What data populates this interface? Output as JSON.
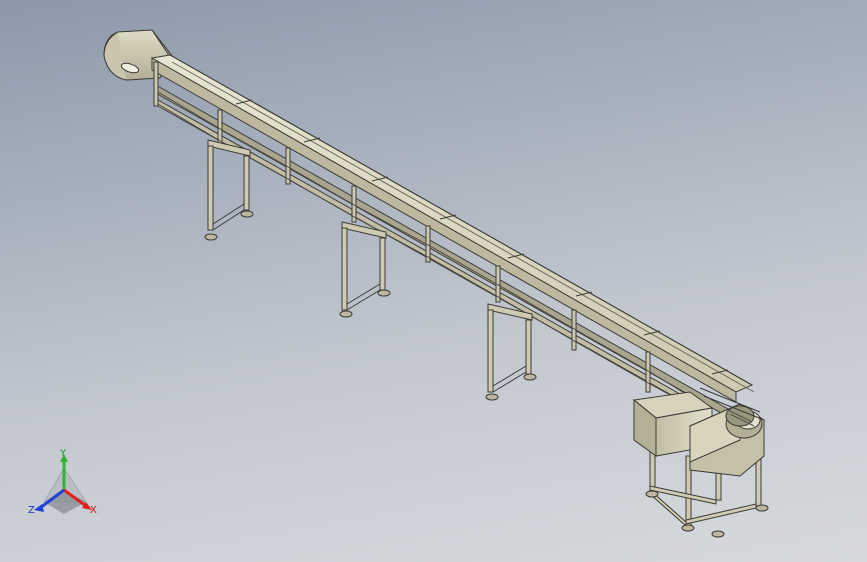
{
  "viewport": {
    "background_top": "#8e98a9",
    "background_bottom": "#d7d9dd"
  },
  "model": {
    "name": "inclined-belt-conveyor",
    "frame_color": "#d9d6c3",
    "shade_color": "#a9a58e",
    "edge_color": "#3b3b36",
    "guard_color": "#c9c6b0"
  },
  "triad": {
    "x_label": "X",
    "y_label": "Y",
    "z_label": "Z",
    "x_color": "#e0201c",
    "y_color": "#2fb52f",
    "z_color": "#2340d8"
  }
}
